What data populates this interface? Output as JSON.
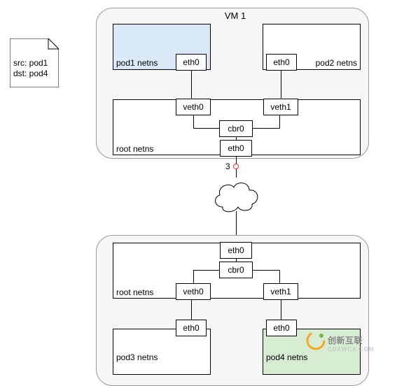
{
  "packet": {
    "line1": "src: pod1",
    "line2": "dst: pod4"
  },
  "vm1": {
    "title": "VM 1",
    "pod1": {
      "netns": "pod1 netns",
      "eth": "eth0"
    },
    "pod2": {
      "netns": "pod2 netns",
      "eth": "eth0"
    },
    "root": {
      "label": "root netns",
      "veth0": "veth0",
      "veth1": "veth1",
      "cbr": "cbr0",
      "eth": "eth0"
    }
  },
  "marker": {
    "label": "3"
  },
  "vm2": {
    "pod3": {
      "netns": "pod3 netns",
      "eth": "eth0"
    },
    "pod4": {
      "netns": "pod4 netns",
      "eth": "eth0"
    },
    "root": {
      "label": "root netns",
      "veth0": "veth0",
      "veth1": "veth1",
      "cbr": "cbr0",
      "eth": "eth0"
    }
  },
  "watermark": {
    "brand": "创新互联",
    "url": "CDXWCX.COM"
  }
}
